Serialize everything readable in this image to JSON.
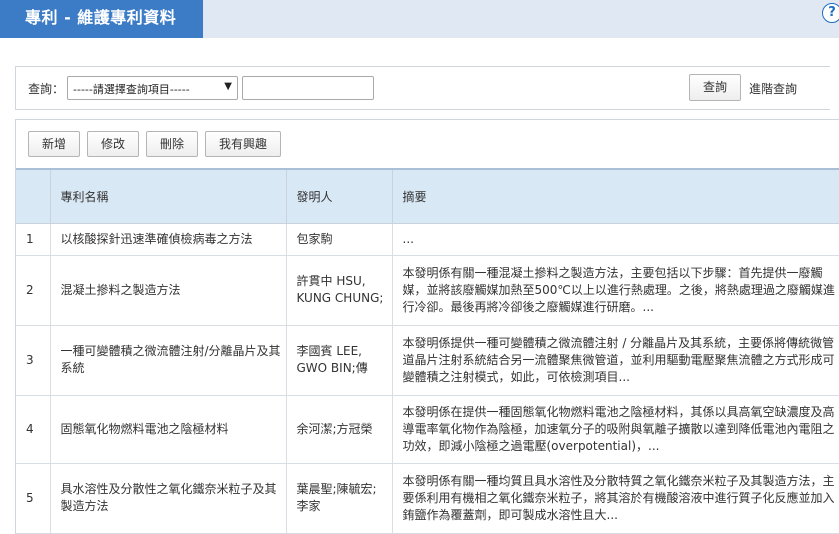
{
  "header": {
    "title": "專利 - 維護專利資料",
    "help_glyph": "?"
  },
  "query": {
    "label": "查詢：",
    "select_value": "-----請選擇查詢項目-----",
    "select_arrow": "▼",
    "input_value": "",
    "search_button": "查詢",
    "advanced_link": "進階查詢"
  },
  "toolbar": {
    "add": "新增",
    "edit": "修改",
    "delete": "刪除",
    "interest": "我有興趣"
  },
  "table": {
    "columns": [
      "",
      "專利名稱",
      "發明人",
      "摘要"
    ],
    "rows": [
      {
        "no": "1",
        "name": "以核酸探針迅速準確偵檢病毒之方法",
        "inventor": "包家駒",
        "abstract": "..."
      },
      {
        "no": "2",
        "name": "混凝土摻料之製造方法",
        "inventor": "許貫中 HSU, KUNG CHUNG;",
        "abstract": "本發明係有關一種混凝土摻料之製造方法，主要包括以下步驟：首先提供一廢觸媒，並將該廢觸媒加熱至500℃以上以進行熱處理。之後，將熱處理過之廢觸媒進行冷卻。最後再將冷卻後之廢觸媒進行研磨。..."
      },
      {
        "no": "3",
        "name": "一種可變體積之微流體注射/分離晶片及其系統",
        "inventor": "李國賓 LEE, GWO BIN;傳",
        "abstract": "本發明係提供一種可變體積之微流體注射 / 分離晶片及其系統，主要係將傳統微管道晶片注射系統結合另一流體聚焦微管道，並利用驅動電壓聚焦流體之方式形成可變體積之注射模式，如此，可依檢測項目..."
      },
      {
        "no": "4",
        "name": "固態氧化物燃料電池之陰極材料",
        "inventor": "余河潔;方冠榮",
        "abstract": "本發明係在提供一種固態氧化物燃料電池之陰極材料，其係以具高氧空缺濃度及高導電率氧化物作為陰極，加速氧分子的吸附與氧離子擴散以達到降低電池內電阻之功效，即減小陰極之過電壓(overpotential)，..."
      },
      {
        "no": "5",
        "name": "具水溶性及分散性之氧化鐵奈米粒子及其製造方法",
        "inventor": "葉晨聖;陳毓宏;李家",
        "abstract": "本發明係有關一種均質且具水溶性及分散特質之氧化鐵奈米粒子及其製造方法，主要係利用有機相之氧化鐵奈米粒子，將其溶於有機酸溶液中進行質子化反應並加入銪鹽作為覆蓋劑，即可製成水溶性且大..."
      }
    ]
  }
}
